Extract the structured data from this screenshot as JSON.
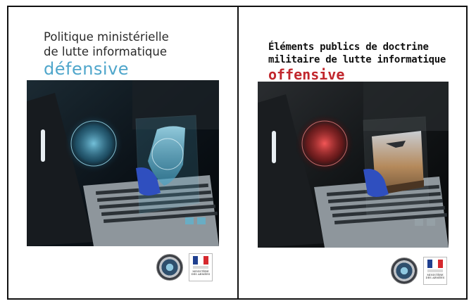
{
  "covers": {
    "left": {
      "title_line1": "Politique ministérielle",
      "title_line2": "de lutte informatique",
      "title_accent": "défensive",
      "accent_color": "#4fa6cb",
      "ministry_label_line1": "MINISTÈRE",
      "ministry_label_line2": "DES ARMÉES",
      "seal_icon": "comcyber-seal-icon"
    },
    "right": {
      "title_line1": "Éléments publics de doctrine",
      "title_line2": "militaire de lutte informatique",
      "title_accent": "offensive",
      "accent_color": "#c1272d",
      "ministry_label_line1": "MINISTÈRE",
      "ministry_label_line2": "DES ARMÉES",
      "seal_icon": "comcyber-seal-icon"
    }
  }
}
